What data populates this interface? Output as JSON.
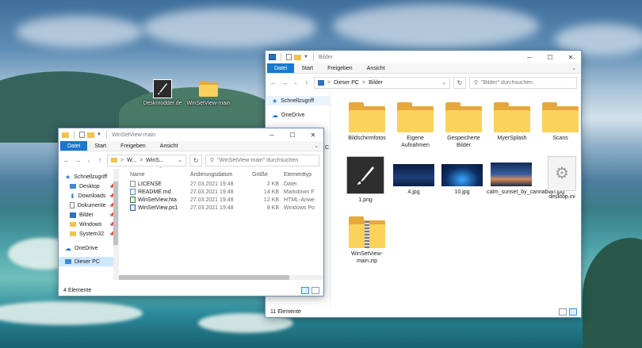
{
  "desktop": {
    "icons": [
      {
        "label": "Deskmodder.de",
        "icon": "app-shortcut-icon"
      },
      {
        "label": "WinSetView-main",
        "icon": "folder-icon"
      }
    ]
  },
  "bilder_window": {
    "title": "Bilder",
    "ribbon": [
      "Datei",
      "Start",
      "Freigeben",
      "Ansicht"
    ],
    "breadcrumb": [
      "Dieser PC",
      "Bilder"
    ],
    "breadcrumb_sep": ">",
    "search_placeholder": "\"Bilder\" durchsuchen",
    "nav": [
      "Schnellzugriff",
      "OneDrive"
    ],
    "items": [
      {
        "label": "Bildschirmfotos",
        "type": "folder"
      },
      {
        "label": "Eigene Aufnahmen",
        "type": "folder"
      },
      {
        "label": "Gespeicherte Bilder",
        "type": "folder"
      },
      {
        "label": "MyerSplash",
        "type": "folder"
      },
      {
        "label": "Scans",
        "type": "folder"
      },
      {
        "label": "1.png",
        "type": "image"
      },
      {
        "label": "4.jpg",
        "type": "image"
      },
      {
        "label": "10.jpg",
        "type": "image"
      },
      {
        "label": "calm_sunset_by_cannabian.jpg",
        "type": "image"
      },
      {
        "label": "desktop.ini",
        "type": "settings"
      },
      {
        "label": "WinSetView-main.zip",
        "type": "zip"
      }
    ],
    "status": "11 Elemente"
  },
  "winset_window": {
    "title": "WinSetView-main",
    "ribbon": [
      "Datei",
      "Start",
      "Freigeben",
      "Ansicht"
    ],
    "breadcrumb": [
      "W...",
      "WinS..."
    ],
    "breadcrumb_sep": ">",
    "search_placeholder": "\"WinSetView-main\" durchsuchen",
    "nav": [
      {
        "label": "Schnellzugriff",
        "pinned": false
      },
      {
        "label": "Desktop",
        "pinned": true
      },
      {
        "label": "Downloads",
        "pinned": true
      },
      {
        "label": "Dokumente",
        "pinned": true
      },
      {
        "label": "Bilder",
        "pinned": true
      },
      {
        "label": "Windows",
        "pinned": true
      },
      {
        "label": "System32",
        "pinned": true
      },
      {
        "label": "OneDrive",
        "pinned": false
      },
      {
        "label": "Dieser PC",
        "pinned": false
      }
    ],
    "columns": [
      "Name",
      "Änderungsdatum",
      "Größe",
      "Elementtyp"
    ],
    "rows": [
      {
        "name": "LICENSE",
        "date": "27.03.2021 19:48",
        "size": "2 KB",
        "type": "Datei"
      },
      {
        "name": "README.md",
        "date": "27.03.2021 19:48",
        "size": "14 KB",
        "type": "Markdown F"
      },
      {
        "name": "WinSetView.hta",
        "date": "27.03.2021 19:48",
        "size": "12 KB",
        "type": "HTML-Anwe"
      },
      {
        "name": "WinSetView.ps1",
        "date": "27.03.2021 19:48",
        "size": "8 KB",
        "type": "Windows Po"
      }
    ],
    "status": "4 Elemente",
    "nav_partial": "C"
  },
  "colors": {
    "accent": "#1979ca",
    "folder": "#fbd25c",
    "selection": "#cde8ff"
  }
}
